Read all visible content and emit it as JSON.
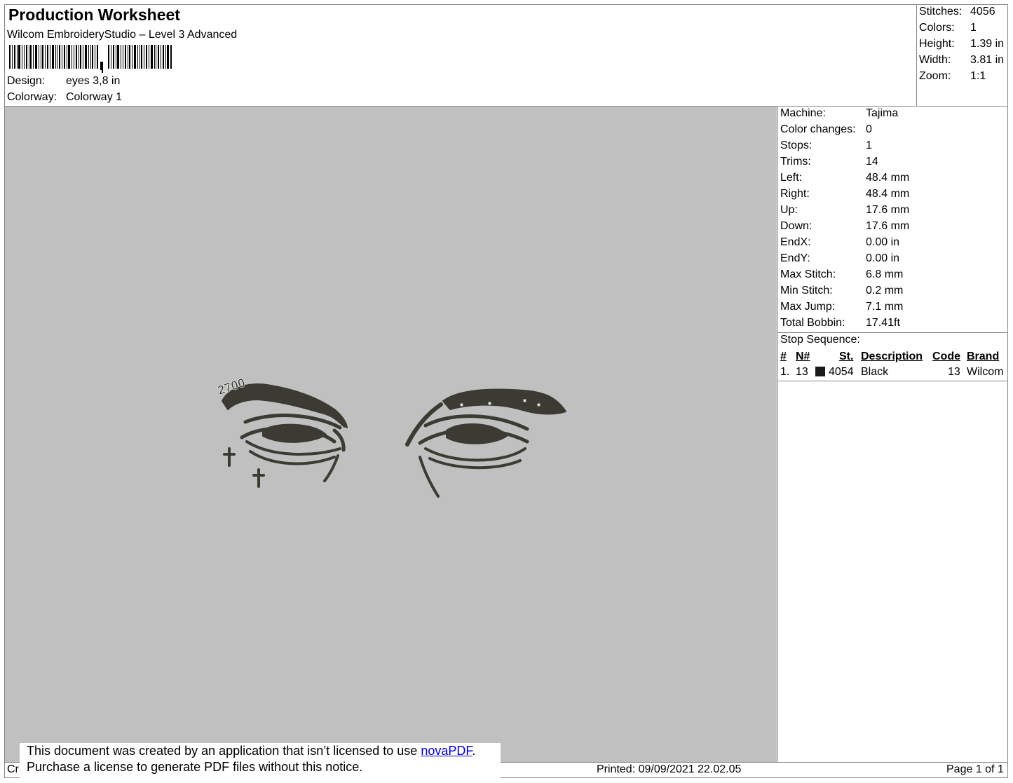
{
  "header": {
    "title": "Production Worksheet",
    "software": "Wilcom EmbroideryStudio – Level 3 Advanced",
    "design_label": "Design:",
    "design_value": "eyes 3,8 in",
    "colorway_label": "Colorway:",
    "colorway_value": "Colorway 1"
  },
  "summary": [
    {
      "label": "Stitches:",
      "value": "4056"
    },
    {
      "label": "Colors:",
      "value": "1"
    },
    {
      "label": "Height:",
      "value": "1.39 in"
    },
    {
      "label": "Width:",
      "value": "3.81 in"
    },
    {
      "label": "Zoom:",
      "value": "1:1"
    }
  ],
  "machine_info": [
    {
      "label": "Machine:",
      "value": "Tajima"
    },
    {
      "label": "Color changes:",
      "value": "0"
    },
    {
      "label": "Stops:",
      "value": "1"
    },
    {
      "label": "Trims:",
      "value": "14"
    },
    {
      "label": "Left:",
      "value": "48.4 mm"
    },
    {
      "label": "Right:",
      "value": "48.4 mm"
    },
    {
      "label": "Up:",
      "value": "17.6 mm"
    },
    {
      "label": "Down:",
      "value": "17.6 mm"
    },
    {
      "label": "EndX:",
      "value": "0.00 in"
    },
    {
      "label": "EndY:",
      "value": "0.00 in"
    },
    {
      "label": "Max Stitch:",
      "value": "6.8 mm"
    },
    {
      "label": "Min Stitch:",
      "value": "0.2 mm"
    },
    {
      "label": "Max Jump:",
      "value": "7.1 mm"
    },
    {
      "label": "Total Bobbin:",
      "value": "17.41ft"
    }
  ],
  "stop_sequence": {
    "title": "Stop Sequence:",
    "headers": {
      "num": "#",
      "n": "N#",
      "st": "St.",
      "description": "Description",
      "code": "Code",
      "brand": "Brand"
    },
    "rows": [
      {
        "num": "1.",
        "n": "13",
        "st": "4054",
        "description": "Black",
        "code": "13",
        "brand": "Wilcom",
        "color": "#1a1a1a"
      }
    ]
  },
  "design_preview": {
    "text": "2700",
    "thread_color": "#3b3a33",
    "background_color": "#c0c0c0"
  },
  "notice": {
    "line1_prefix": "This document was created by an application that isn’t licensed to use ",
    "link": "novaPDF",
    "line1_suffix": ".",
    "line2": "Purchase a license to generate PDF files without this notice."
  },
  "footer": {
    "left_fragment": "Cr",
    "printed": "Printed: 09/09/2021 22.02.05",
    "page": "Page 1 of 1"
  }
}
